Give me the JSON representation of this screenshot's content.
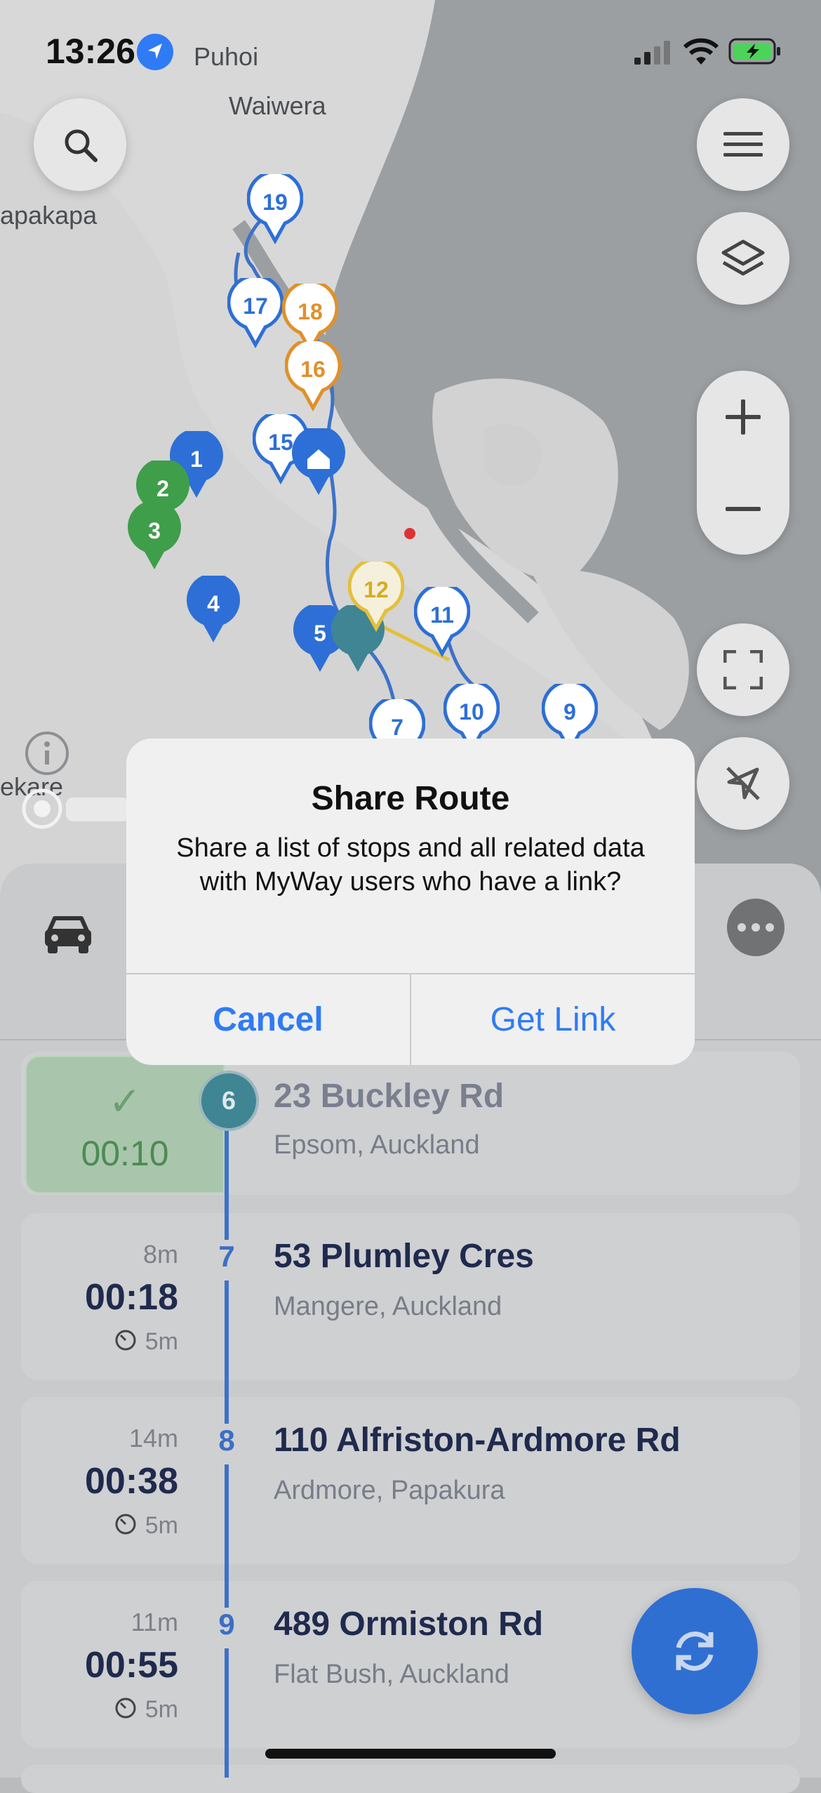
{
  "status_bar": {
    "time": "13:26"
  },
  "map": {
    "place_labels": [
      "Puhoi",
      "Waiwera",
      "apakapa",
      "ekare"
    ],
    "markers": [
      {
        "label": "19",
        "color": "#2d6fd6"
      },
      {
        "label": "17",
        "color": "#2d6fd6"
      },
      {
        "label": "18",
        "color": "#e0902b"
      },
      {
        "label": "16",
        "color": "#e0902b"
      },
      {
        "label": "15",
        "color": "#2d6fd6"
      },
      {
        "label": "1",
        "color": "#2d6fd6"
      },
      {
        "label": "2",
        "color": "#3f9e4a"
      },
      {
        "label": "3",
        "color": "#3f9e4a"
      },
      {
        "label": "4",
        "color": "#2d6fd6"
      },
      {
        "label": "5",
        "color": "#2d6fd6"
      },
      {
        "label": "12",
        "color": "#e3c03a"
      },
      {
        "label": "11",
        "color": "#2d6fd6"
      },
      {
        "label": "10",
        "color": "#2d6fd6"
      },
      {
        "label": "9",
        "color": "#2d6fd6"
      },
      {
        "label": "7",
        "color": "#2d6fd6"
      }
    ],
    "controls": [
      "search-icon",
      "menu-icon",
      "layers-icon",
      "zoom-in-icon",
      "zoom-out-icon",
      "fullscreen-icon",
      "location-off-icon",
      "info-icon"
    ]
  },
  "dialog": {
    "title": "Share Route",
    "message": "Share a list of stops and all related data with MyWay users who have a link?",
    "cancel_label": "Cancel",
    "confirm_label": "Get Link"
  },
  "stops": [
    {
      "num": "6",
      "address": "23 Buckley Rd",
      "area": "Epsom, Auckland",
      "done": true,
      "check": "✓",
      "eta": "00:10"
    },
    {
      "num": "7",
      "address": "53 Plumley Cres",
      "area": "Mangere, Auckland",
      "drive": "8m",
      "eta": "00:18",
      "service": "5m"
    },
    {
      "num": "8",
      "address": "110 Alfriston-Ardmore Rd",
      "area": "Ardmore, Papakura",
      "drive": "14m",
      "eta": "00:38",
      "service": "5m"
    },
    {
      "num": "9",
      "address": "489 Ormiston Rd",
      "area": "Flat Bush, Auckland",
      "drive": "11m",
      "eta": "00:55",
      "service": "5m"
    }
  ],
  "colors": {
    "accent": "#2f7bf5",
    "route_blue": "#3d72c8",
    "done_green": "#4c8b52"
  }
}
